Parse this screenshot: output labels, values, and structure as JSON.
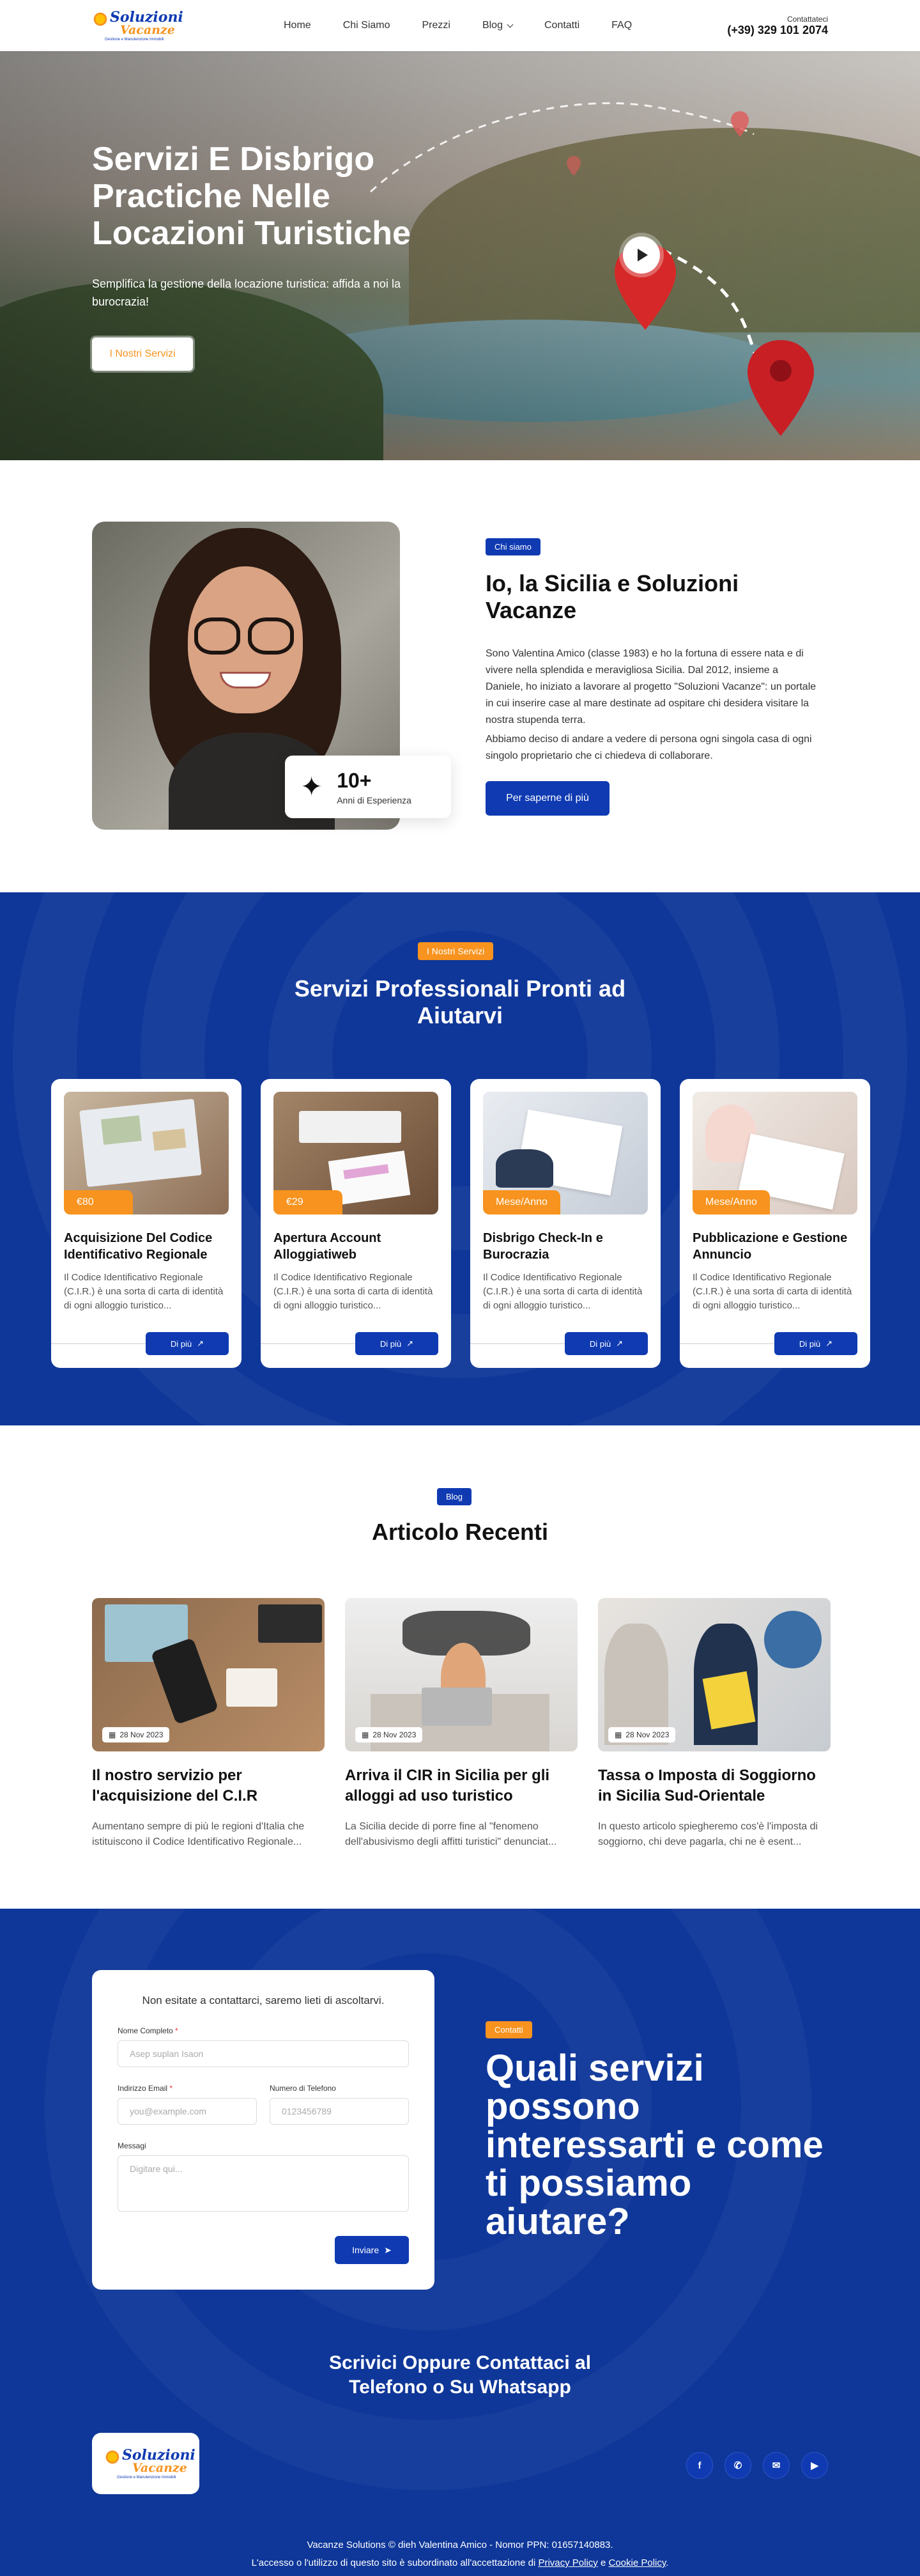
{
  "header": {
    "logo": {
      "line1": "Soluzioni",
      "line2": "Vacanze",
      "tagline": "Gestione e Manutenzione Immobili"
    },
    "nav": [
      {
        "label": "Home"
      },
      {
        "label": "Chi Siamo"
      },
      {
        "label": "Prezzi"
      },
      {
        "label": "Blog"
      },
      {
        "label": "Contatti"
      },
      {
        "label": "FAQ"
      }
    ],
    "contact_label": "Contattateci",
    "phone": "(+39) 329 101 2074"
  },
  "hero": {
    "title": "Servizi E Disbrigo Practiche Nelle Locazioni Turistiche",
    "subtitle": "Semplifica la gestione della locazione turistica: affida a noi la burocrazia!",
    "button": "I Nostri Servizi"
  },
  "about": {
    "badge": "Chi siamo",
    "title": "Io, la Sicilia e Soluzioni Vacanze",
    "paragraphs": [
      "Sono Valentina Amico (classe 1983) e ho la fortuna di essere nata e di vivere nella splendida e meravigliosa Sicilia. Dal 2012, insieme a Daniele, ho iniziato a lavorare al progetto \"Soluzioni Vacanze\": un portale in cui inserire case al mare destinate ad ospitare chi desidera visitare la nostra stupenda terra.",
      "Abbiamo deciso di andare a vedere di persona ogni singola casa di ogni singolo proprietario che ci chiedeva di collaborare."
    ],
    "experience_number": "10+",
    "experience_label": "Anni di Esperienza",
    "button": "Per saperne di più"
  },
  "services": {
    "badge": "I Nostri Servizi",
    "title": "Servizi Professionali Pronti ad Aiutarvi",
    "cards": [
      {
        "price": "€80",
        "title": "Acquisizione Del Codice Identificativo Regionale",
        "desc": "Il Codice Identificativo Regionale (C.I.R.) è una sorta di carta di identità di ogni alloggio turistico...",
        "button": "Di più"
      },
      {
        "price": "€29",
        "title": "Apertura Account Alloggiatiweb",
        "desc": "Il Codice Identificativo Regionale (C.I.R.) è una sorta di carta di identità di ogni alloggio turistico...",
        "button": "Di più"
      },
      {
        "price": "Mese/Anno",
        "title": "Disbrigo Check-In e Burocrazia",
        "desc": "Il Codice Identificativo Regionale (C.I.R.) è una sorta di carta di identità di ogni alloggio turistico...",
        "button": "Di più"
      },
      {
        "price": "Mese/Anno",
        "title": "Pubblicazione e Gestione Annuncio",
        "desc": "Il Codice Identificativo Regionale (C.I.R.) è una sorta di carta di identità di ogni alloggio turistico...",
        "button": "Di più"
      }
    ]
  },
  "blog": {
    "badge": "Blog",
    "title": "Articolo Recenti",
    "posts": [
      {
        "date": "28 Nov 2023",
        "title": "Il nostro servizio per l'acquisizione del C.I.R",
        "excerpt": "Aumentano sempre di più le regioni d'Italia che istituiscono il Codice Identificativo Regionale..."
      },
      {
        "date": "28 Nov 2023",
        "title": "Arriva il CIR in Sicilia per gli alloggi ad uso turistico",
        "excerpt": "La Sicilia decide di porre fine al \"fenomeno dell'abusivismo degli affitti turistici\" denunciat..."
      },
      {
        "date": "28 Nov 2023",
        "title": "Tassa o Imposta di Soggiorno in Sicilia Sud-Orientale",
        "excerpt": "In questo articolo spiegheremo cos'è l'imposta di soggiorno, chi deve pagarla, chi ne è esent..."
      }
    ]
  },
  "contact": {
    "form_intro": "Non esitate a contattarci, saremo lieti di ascoltarvi.",
    "name_label": "Nome Completo",
    "name_placeholder": "Asep suplan Isaon",
    "email_label": "Indirizzo Email",
    "email_placeholder": "you@example.com",
    "phone_label": "Numero di Telefono",
    "phone_placeholder": "0123456789",
    "message_label": "Messagi",
    "message_placeholder": "Digitare qui...",
    "send": "Inviare",
    "badge": "Contatti",
    "title": "Quali servizi possono interessarti e come ti possiamo aiutare?",
    "subtitle": "Scrivici Oppure Contattaci al Telefono o Su Whatsapp"
  },
  "footer": {
    "copyright": "Vacanze Solutions © dieh Valentina Amico - Nomor PPN: 01657140883.",
    "terms_prefix": "L'accesso o l'utilizzo di questo sito è subordinato all'accettazione di",
    "privacy": "Privacy Policy",
    "and": "e",
    "cookie": "Cookie Policy",
    "terms_suffix": "."
  },
  "colors": {
    "primary": "#0f3ab2",
    "accent": "#f7931e",
    "dark_blue": "#0f3799"
  },
  "icons": [
    "play-icon",
    "map-pin-icon",
    "sparkle-icon",
    "arrow-up-right-icon",
    "calendar-icon",
    "send-icon",
    "facebook-icon",
    "whatsapp-icon",
    "mail-icon",
    "youtube-icon"
  ]
}
